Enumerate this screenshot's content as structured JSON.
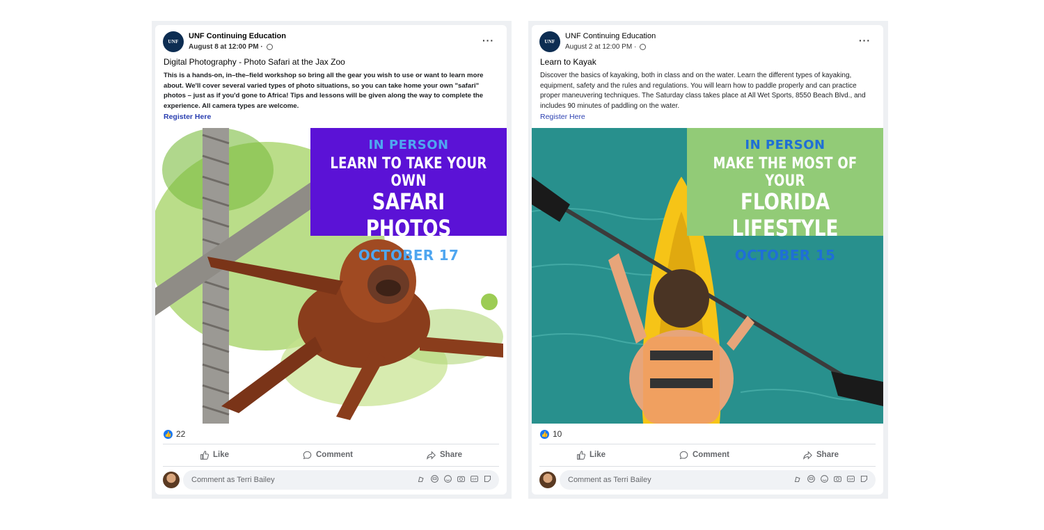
{
  "posts": [
    {
      "author": "UNF Continuing Education",
      "avatar_text": "UNF",
      "date": "August 8 at 12:00 PM · ",
      "more": "···",
      "title": "Digital Photography - Photo Safari at the Jax Zoo",
      "body": "This is a hands-on, in–the–field workshop so bring all the gear you wish to use or want to learn more about. We'll cover several varied types of photo situations, so you can take home your own \"safari\" photos – just as if you'd gone to Africa! Tips and lessons will be given along the way to complete the experience. All camera types are welcome.",
      "register": "Register Here",
      "banner": {
        "line1": "IN PERSON",
        "line2": "LEARN TO TAKE YOUR OWN",
        "line3": "SAFARI PHOTOS",
        "line4": "OCTOBER 17",
        "bg": "#5b12d6",
        "accent": "#4fa6f0"
      },
      "likes": "22",
      "actions": {
        "like": "Like",
        "comment": "Comment",
        "share": "Share"
      },
      "comment_placeholder": "Comment as Terri Bailey"
    },
    {
      "author": "UNF Continuing Education",
      "avatar_text": "UNF",
      "date": "August 2 at 12:00 PM · ",
      "more": "···",
      "title": "Learn to Kayak",
      "body": "Discover the basics of kayaking, both in class and on the water. Learn the different types of kayaking, equipment, safety and the rules and regulations. You will learn how to paddle properly and can practice proper maneuvering techniques. The Saturday class takes place at All Wet Sports, 8550 Beach Blvd., and includes 90 minutes of paddling on the water.",
      "register": "Register Here",
      "banner": {
        "line1": "IN PERSON",
        "line2": "MAKE THE MOST OF YOUR",
        "line3": "FLORIDA LIFESTYLE",
        "line4": "OCTOBER 15",
        "bg": "#92cb77",
        "accent": "#1f6fd6"
      },
      "likes": "10",
      "actions": {
        "like": "Like",
        "comment": "Comment",
        "share": "Share"
      },
      "comment_placeholder": "Comment as Terri Bailey"
    }
  ],
  "icons": [
    "thumbs-up-icon",
    "comment-icon",
    "share-icon",
    "globe-icon",
    "sticker-icon",
    "avatar-icon",
    "emoji-icon",
    "camera-icon",
    "gif-icon",
    "sticker-face-icon"
  ]
}
